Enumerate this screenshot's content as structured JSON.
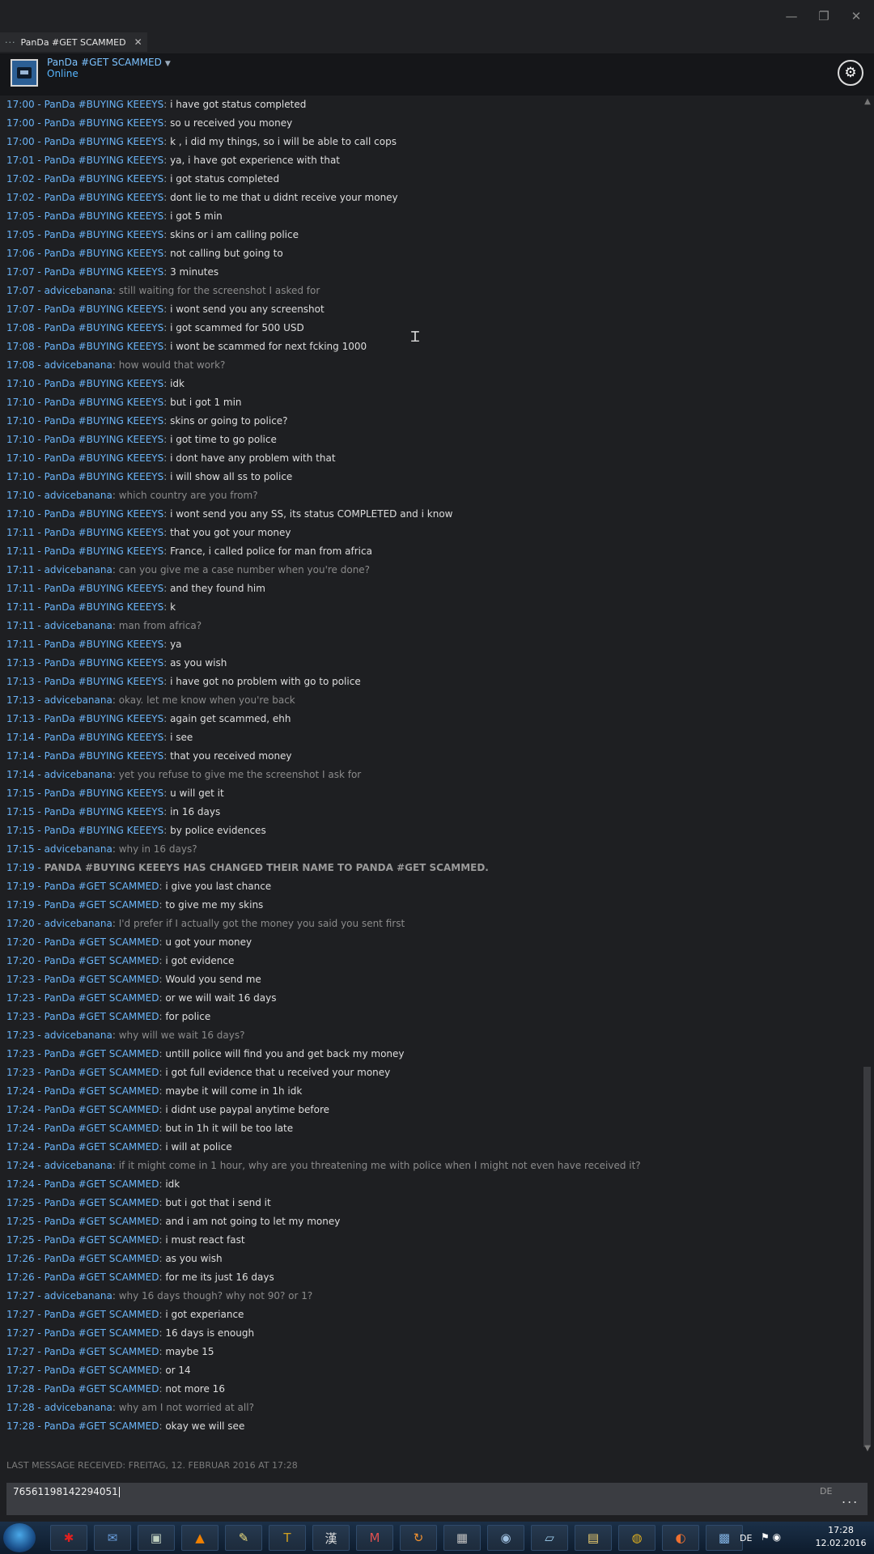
{
  "window": {
    "minimize": "—",
    "restore": "❐",
    "close": "✕"
  },
  "tab": {
    "label": "PanDa #GET SCAMMED"
  },
  "friend": {
    "name": "PanDa #GET SCAMMED",
    "status": "Online"
  },
  "messages": [
    {
      "time": "17:00",
      "name": "PanDa #BUYING KEEEYS",
      "text": "i have got status completed",
      "kind": "friend"
    },
    {
      "time": "17:00",
      "name": "PanDa #BUYING KEEEYS",
      "text": "so u received you money",
      "kind": "friend"
    },
    {
      "time": "17:00",
      "name": "PanDa #BUYING KEEEYS",
      "text": "k , i did my things, so i will be able to call cops",
      "kind": "friend"
    },
    {
      "time": "17:01",
      "name": "PanDa #BUYING KEEEYS",
      "text": "ya, i have got experience with that",
      "kind": "friend"
    },
    {
      "time": "17:02",
      "name": "PanDa #BUYING KEEEYS",
      "text": "i got status completed",
      "kind": "friend"
    },
    {
      "time": "17:02",
      "name": "PanDa #BUYING KEEEYS",
      "text": "dont lie to me that u didnt receive your money",
      "kind": "friend"
    },
    {
      "time": "17:05",
      "name": "PanDa #BUYING KEEEYS",
      "text": "i got 5 min",
      "kind": "friend"
    },
    {
      "time": "17:05",
      "name": "PanDa #BUYING KEEEYS",
      "text": "skins or i am calling police",
      "kind": "friend"
    },
    {
      "time": "17:06",
      "name": "PanDa #BUYING KEEEYS",
      "text": "not calling but going to",
      "kind": "friend"
    },
    {
      "time": "17:07",
      "name": "PanDa #BUYING KEEEYS",
      "text": "3 minutes",
      "kind": "friend"
    },
    {
      "time": "17:07",
      "name": "advicebanana",
      "text": "still waiting for the screenshot I asked for",
      "kind": "self"
    },
    {
      "time": "17:07",
      "name": "PanDa #BUYING KEEEYS",
      "text": "i wont send you any screenshot",
      "kind": "friend"
    },
    {
      "time": "17:08",
      "name": "PanDa #BUYING KEEEYS",
      "text": "i got scammed for 500 USD",
      "kind": "friend"
    },
    {
      "time": "17:08",
      "name": "PanDa #BUYING KEEEYS",
      "text": "i wont be scammed for next fcking 1000",
      "kind": "friend"
    },
    {
      "time": "17:08",
      "name": "advicebanana",
      "text": "how would that work?",
      "kind": "self"
    },
    {
      "time": "17:10",
      "name": "PanDa #BUYING KEEEYS",
      "text": "idk",
      "kind": "friend"
    },
    {
      "time": "17:10",
      "name": "PanDa #BUYING KEEEYS",
      "text": "but i got 1 min",
      "kind": "friend"
    },
    {
      "time": "17:10",
      "name": "PanDa #BUYING KEEEYS",
      "text": "skins or going to police?",
      "kind": "friend"
    },
    {
      "time": "17:10",
      "name": "PanDa #BUYING KEEEYS",
      "text": "i got time to go police",
      "kind": "friend"
    },
    {
      "time": "17:10",
      "name": "PanDa #BUYING KEEEYS",
      "text": "i dont have any problem with that",
      "kind": "friend"
    },
    {
      "time": "17:10",
      "name": "PanDa #BUYING KEEEYS",
      "text": "i will show all ss to police",
      "kind": "friend"
    },
    {
      "time": "17:10",
      "name": "advicebanana",
      "text": "which country are you from?",
      "kind": "self"
    },
    {
      "time": "17:10",
      "name": "PanDa #BUYING KEEEYS",
      "text": "i wont send you any SS, its status COMPLETED and i know",
      "kind": "friend"
    },
    {
      "time": "17:11",
      "name": "PanDa #BUYING KEEEYS",
      "text": "that you got your money",
      "kind": "friend"
    },
    {
      "time": "17:11",
      "name": "PanDa #BUYING KEEEYS",
      "text": "France, i called police for man from africa",
      "kind": "friend"
    },
    {
      "time": "17:11",
      "name": "advicebanana",
      "text": "can you give me a case number when you're done?",
      "kind": "self"
    },
    {
      "time": "17:11",
      "name": "PanDa #BUYING KEEEYS",
      "text": "and they found him",
      "kind": "friend"
    },
    {
      "time": "17:11",
      "name": "PanDa #BUYING KEEEYS",
      "text": "k",
      "kind": "friend"
    },
    {
      "time": "17:11",
      "name": "advicebanana",
      "text": "man from africa?",
      "kind": "self"
    },
    {
      "time": "17:11",
      "name": "PanDa #BUYING KEEEYS",
      "text": "ya",
      "kind": "friend"
    },
    {
      "time": "17:13",
      "name": "PanDa #BUYING KEEEYS",
      "text": "as you wish",
      "kind": "friend"
    },
    {
      "time": "17:13",
      "name": "PanDa #BUYING KEEEYS",
      "text": "i have got no problem with go to police",
      "kind": "friend"
    },
    {
      "time": "17:13",
      "name": "advicebanana",
      "text": "okay. let me know when you're back",
      "kind": "self"
    },
    {
      "time": "17:13",
      "name": "PanDa #BUYING KEEEYS",
      "text": "again get scammed, ehh",
      "kind": "friend"
    },
    {
      "time": "17:14",
      "name": "PanDa #BUYING KEEEYS",
      "text": "i see",
      "kind": "friend"
    },
    {
      "time": "17:14",
      "name": "PanDa #BUYING KEEEYS",
      "text": "that you received money",
      "kind": "friend"
    },
    {
      "time": "17:14",
      "name": "advicebanana",
      "text": "yet you refuse to give me the screenshot I ask for",
      "kind": "self"
    },
    {
      "time": "17:15",
      "name": "PanDa #BUYING KEEEYS",
      "text": "u will get it",
      "kind": "friend"
    },
    {
      "time": "17:15",
      "name": "PanDa #BUYING KEEEYS",
      "text": "in 16 days",
      "kind": "friend"
    },
    {
      "time": "17:15",
      "name": "PanDa #BUYING KEEEYS",
      "text": "by police evidences",
      "kind": "friend"
    },
    {
      "time": "17:15",
      "name": "advicebanana",
      "text": "why in 16 days?",
      "kind": "self"
    },
    {
      "time": "17:19",
      "name": "",
      "text": "PanDa #BUYING KEEEYS has changed their name to PanDa #GET SCAMMED.",
      "kind": "sys"
    },
    {
      "time": "17:19",
      "name": "PanDa #GET SCAMMED",
      "text": "i give you last chance",
      "kind": "friend"
    },
    {
      "time": "17:19",
      "name": "PanDa #GET SCAMMED",
      "text": "to give me my skins",
      "kind": "friend"
    },
    {
      "time": "17:20",
      "name": "advicebanana",
      "text": "I'd prefer if I actually got the money you said you sent first",
      "kind": "self"
    },
    {
      "time": "17:20",
      "name": "PanDa #GET SCAMMED",
      "text": "u got your money",
      "kind": "friend"
    },
    {
      "time": "17:20",
      "name": "PanDa #GET SCAMMED",
      "text": "i got evidence",
      "kind": "friend"
    },
    {
      "time": "17:23",
      "name": "PanDa #GET SCAMMED",
      "text": "Would you send me",
      "kind": "friend"
    },
    {
      "time": "17:23",
      "name": "PanDa #GET SCAMMED",
      "text": "or we will wait 16 days",
      "kind": "friend"
    },
    {
      "time": "17:23",
      "name": "PanDa #GET SCAMMED",
      "text": "for police",
      "kind": "friend"
    },
    {
      "time": "17:23",
      "name": "advicebanana",
      "text": "why will we wait 16 days?",
      "kind": "self"
    },
    {
      "time": "17:23",
      "name": "PanDa #GET SCAMMED",
      "text": "untill police will find you and get back my money",
      "kind": "friend"
    },
    {
      "time": "17:23",
      "name": "PanDa #GET SCAMMED",
      "text": "i got full evidence that u received your money",
      "kind": "friend"
    },
    {
      "time": "17:24",
      "name": "PanDa #GET SCAMMED",
      "text": "maybe it will come in 1h idk",
      "kind": "friend"
    },
    {
      "time": "17:24",
      "name": "PanDa #GET SCAMMED",
      "text": "i didnt use paypal anytime before",
      "kind": "friend"
    },
    {
      "time": "17:24",
      "name": "PanDa #GET SCAMMED",
      "text": "but in 1h it will be too late",
      "kind": "friend"
    },
    {
      "time": "17:24",
      "name": "PanDa #GET SCAMMED",
      "text": "i will at police",
      "kind": "friend"
    },
    {
      "time": "17:24",
      "name": "advicebanana",
      "text": "if it might come in 1 hour, why are you threatening me with police when I might not even have received it?",
      "kind": "self"
    },
    {
      "time": "17:24",
      "name": "PanDa #GET SCAMMED",
      "text": "idk",
      "kind": "friend"
    },
    {
      "time": "17:25",
      "name": "PanDa #GET SCAMMED",
      "text": "but i got that i send it",
      "kind": "friend"
    },
    {
      "time": "17:25",
      "name": "PanDa #GET SCAMMED",
      "text": "and i am not going to let my money",
      "kind": "friend"
    },
    {
      "time": "17:25",
      "name": "PanDa #GET SCAMMED",
      "text": "i must react fast",
      "kind": "friend"
    },
    {
      "time": "17:26",
      "name": "PanDa #GET SCAMMED",
      "text": "as you wish",
      "kind": "friend"
    },
    {
      "time": "17:26",
      "name": "PanDa #GET SCAMMED",
      "text": "for me its just 16 days",
      "kind": "friend"
    },
    {
      "time": "17:27",
      "name": "advicebanana",
      "text": "why 16 days though? why not 90? or 1?",
      "kind": "self"
    },
    {
      "time": "17:27",
      "name": "PanDa #GET SCAMMED",
      "text": "i got experiance",
      "kind": "friend"
    },
    {
      "time": "17:27",
      "name": "PanDa #GET SCAMMED",
      "text": "16 days is enough",
      "kind": "friend"
    },
    {
      "time": "17:27",
      "name": "PanDa #GET SCAMMED",
      "text": "maybe 15",
      "kind": "friend"
    },
    {
      "time": "17:27",
      "name": "PanDa #GET SCAMMED",
      "text": "or 14",
      "kind": "friend"
    },
    {
      "time": "17:28",
      "name": "PanDa #GET SCAMMED",
      "text": "not more 16",
      "kind": "friend"
    },
    {
      "time": "17:28",
      "name": "advicebanana",
      "text": "why am I not worried at all?",
      "kind": "self"
    },
    {
      "time": "17:28",
      "name": "PanDa #GET SCAMMED",
      "text": "okay we will see",
      "kind": "friend"
    }
  ],
  "last_received": "Last message received: Freitag, 12. Februar 2016 at 17:28",
  "input": {
    "value": "76561198142294051",
    "lang": "DE",
    "more": "..."
  },
  "taskbar": {
    "apps": [
      "lobster-app",
      "thunderbird-app",
      "terminal-app",
      "vlc-app",
      "notepad-app",
      "tex-app",
      "kanji-app",
      "m-app",
      "sync-app",
      "calculator-app",
      "steam-app",
      "note-app",
      "folder-app",
      "chrome-app",
      "firefox-app",
      "control-panel-app"
    ],
    "lang": "DE",
    "time": "17:28",
    "date": "12.02.2016"
  },
  "colors": {
    "name": "#6ab4f7",
    "message": "#dedede",
    "self_message": "#8b8b8b",
    "background": "#1e1f22"
  }
}
